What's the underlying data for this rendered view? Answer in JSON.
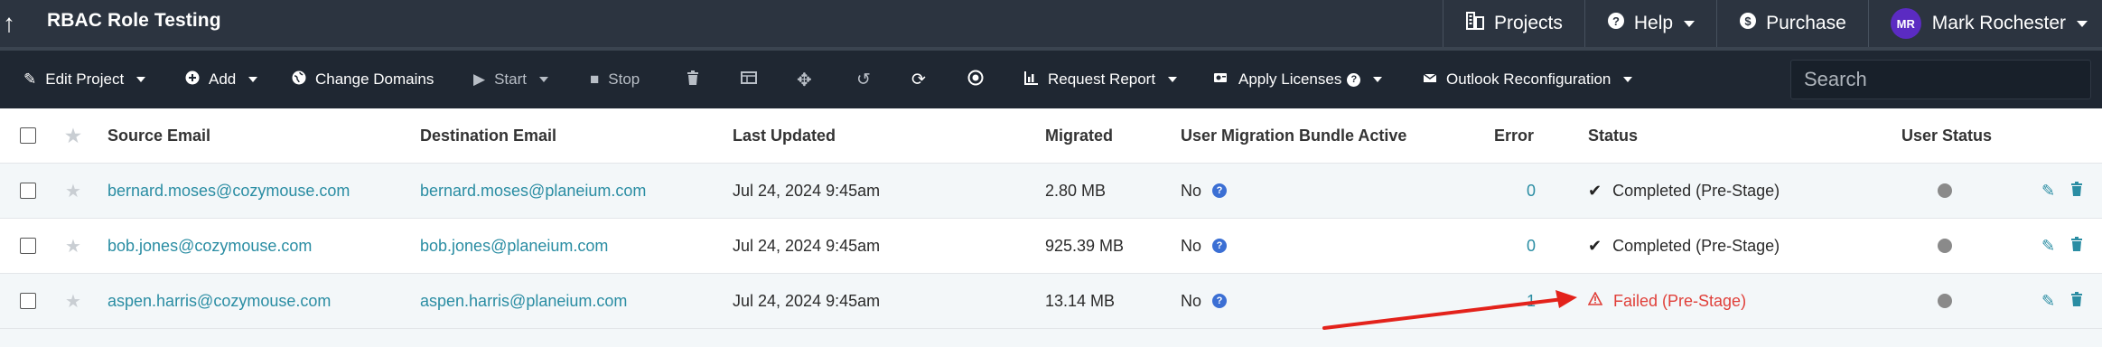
{
  "header": {
    "back_icon": "arrow-up-icon",
    "title": "RBAC Role Testing",
    "projects": "Projects",
    "help": "Help",
    "purchase": "Purchase",
    "avatar_initials": "MR",
    "user_name": "Mark Rochester",
    "avatar_color": "#5b2bc2",
    "nav_bg": "#2c3440"
  },
  "toolbar": {
    "edit_project": "Edit Project",
    "add": "Add",
    "change_domains": "Change Domains",
    "start": "Start",
    "stop": "Stop",
    "request_report": "Request Report",
    "apply_licenses": "Apply Licenses",
    "outlook_reconfiguration": "Outlook Reconfiguration",
    "search_placeholder": "Search",
    "bg": "#1f2732"
  },
  "table": {
    "columns": [
      "Source Email",
      "Destination Email",
      "Last Updated",
      "Migrated",
      "User Migration Bundle Active",
      "Error",
      "Status",
      "User Status"
    ],
    "rows": [
      {
        "source": "bernard.moses@cozymouse.com",
        "destination": "bernard.moses@planeium.com",
        "last_updated": "Jul 24, 2024 9:45am",
        "migrated": "2.80 MB",
        "bundle_active": "No",
        "error": "0",
        "status": "Completed (Pre-Stage)",
        "status_type": "completed"
      },
      {
        "source": "bob.jones@cozymouse.com",
        "destination": "bob.jones@planeium.com",
        "last_updated": "Jul 24, 2024 9:45am",
        "migrated": "925.39 MB",
        "bundle_active": "No",
        "error": "0",
        "status": "Completed (Pre-Stage)",
        "status_type": "completed"
      },
      {
        "source": "aspen.harris@cozymouse.com",
        "destination": "aspen.harris@planeium.com",
        "last_updated": "Jul 24, 2024 9:45am",
        "migrated": "13.14 MB",
        "bundle_active": "No",
        "error": "1",
        "status": "Failed (Pre-Stage)",
        "status_type": "failed"
      }
    ],
    "link_color": "#2a8da3",
    "failed_color": "#e0403a"
  },
  "annotation": {
    "arrow_color": "#e3221b"
  }
}
